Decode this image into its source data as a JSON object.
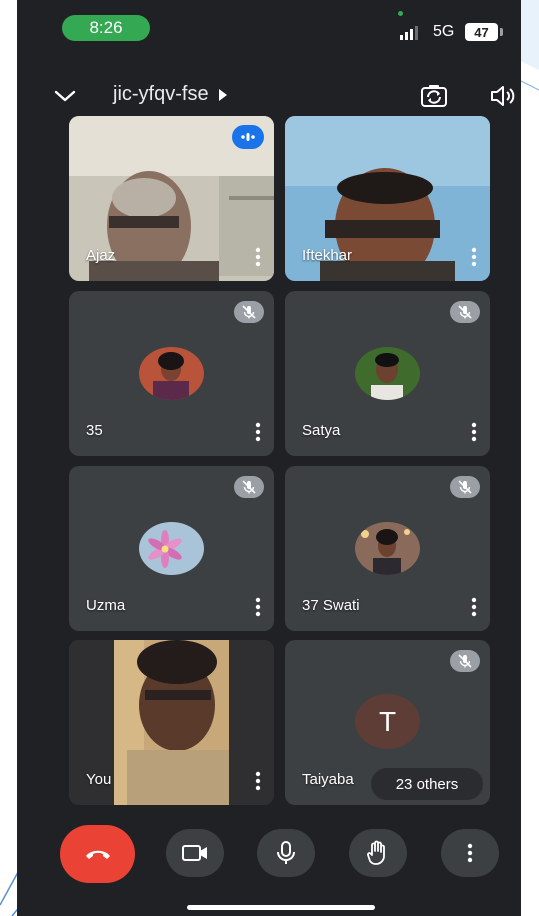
{
  "status_bar": {
    "time": "8:26",
    "network": "5G",
    "battery": "47",
    "colors": {
      "clock_pill": "#34a853",
      "background": "#202124"
    }
  },
  "meeting": {
    "code": "jic-yfqv-fse",
    "icons": [
      "chevron-down-icon",
      "caret-right-icon",
      "camera-flip-icon",
      "speaker-icon"
    ]
  },
  "participants": [
    {
      "name": "Ajaz",
      "state": "video",
      "speaking": true
    },
    {
      "name": "Iftekhar",
      "state": "video"
    },
    {
      "name": "35",
      "state": "avatar",
      "muted": true
    },
    {
      "name": "Satya",
      "state": "avatar",
      "muted": true
    },
    {
      "name": "Uzma",
      "state": "avatar",
      "muted": true
    },
    {
      "name": "37 Swati",
      "state": "avatar",
      "muted": true
    },
    {
      "name": "You",
      "state": "video"
    },
    {
      "name": "Taiyaba",
      "state": "letter",
      "initial": "T",
      "muted": true,
      "others_label": "23 others"
    }
  ],
  "controls": [
    "end-call-icon",
    "camera-icon",
    "microphone-icon",
    "raise-hand-icon",
    "more-vert-icon"
  ],
  "colors": {
    "tile": "#3c4043",
    "end_call": "#ea4335",
    "speaking": "#1a73e8",
    "mute_badge": "#9aa0a6"
  }
}
